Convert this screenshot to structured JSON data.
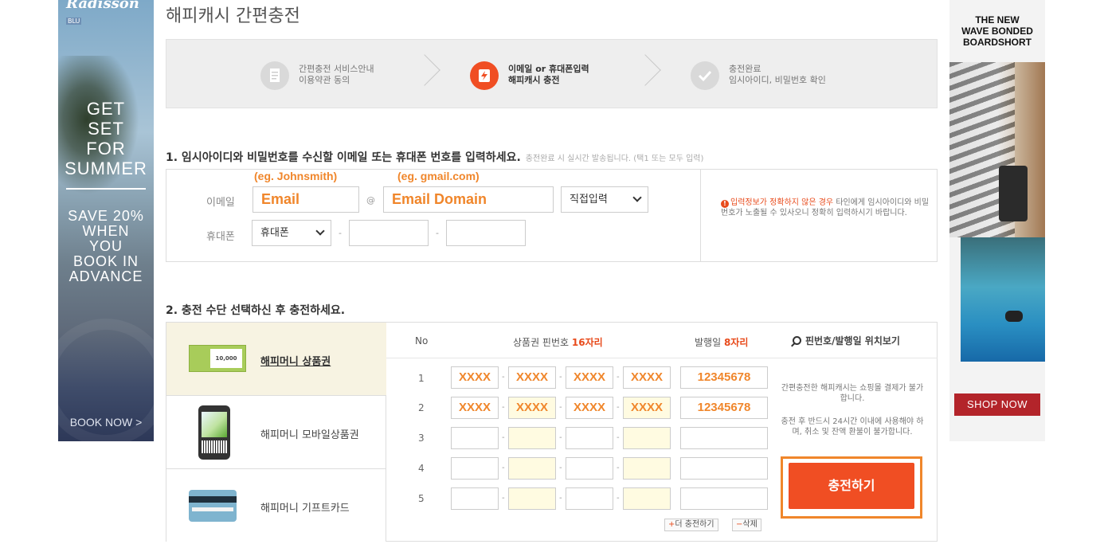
{
  "ads": {
    "left": {
      "brand": "Radisson",
      "brand_tag": "BLU",
      "headline_lines": [
        "GET",
        "SET",
        "FOR",
        "SUMMER"
      ],
      "offer_lines": [
        "SAVE 20%",
        "WHEN",
        "YOU",
        "BOOK IN",
        "ADVANCE"
      ],
      "cta": "BOOK NOW >"
    },
    "right": {
      "headline_lines": [
        "THE NEW",
        "WAVE BONDED",
        "BOARDSHORT"
      ],
      "cta": "SHOP NOW"
    }
  },
  "page": {
    "title": "해피캐시 간편충전"
  },
  "steps": [
    {
      "line1": "간편충전 서비스안내",
      "line2": "이용약관 동의",
      "icon": "document-icon",
      "active": false
    },
    {
      "line1": "이메일 or 휴대폰입력",
      "line2": "해피캐시 충전",
      "icon": "charge-icon",
      "active": true
    },
    {
      "line1": "충전완료",
      "line2": "임시아이디, 비밀번호 확인",
      "icon": "check-icon",
      "active": false
    }
  ],
  "section1": {
    "title": "1. 임시아이디와 비밀번호를 수신할 이메일 또는 휴대폰 번호를 입력하세요.",
    "hint": "충전완료 시 실시간 발송됩니다. (택1 또는 모두 입력)",
    "email_label": "이메일",
    "email_example": "(eg. Johnsmith)",
    "domain_example": "(eg. gmail.com)",
    "email_value": "Email",
    "at": "@",
    "domain_value": "Email Domain",
    "domain_select": "직접입력",
    "phone_label": "휴대폰",
    "phone_select": "휴대폰",
    "phone_dash": "-",
    "warning_highlight": "입력정보가 정확하지 않은 경우",
    "warning_rest": " 타인에게 임시아이디와 비밀번호가 노출될 수 있사오니 정확히 입력하시기 바랍니다."
  },
  "section2": {
    "title": "2. 충전 수단 선택하신 후 충전하세요.",
    "methods": [
      {
        "label": "해피머니 상품권",
        "active": true
      },
      {
        "label": "해피머니 모바일상품권",
        "active": false
      },
      {
        "label": "해피머니 기프트카드",
        "active": false
      }
    ],
    "voucher_text": "10,000",
    "columns": {
      "no": "No",
      "pin": "상품권 핀번호",
      "pin_len": "16자리",
      "issue": "발행일",
      "issue_len": "8자리",
      "find": "핀번호/발행일 위치보기"
    },
    "rows": [
      {
        "no": "1",
        "pins": [
          "XXXX",
          "XXXX",
          "XXXX",
          "XXXX"
        ],
        "date": "12345678"
      },
      {
        "no": "2",
        "pins": [
          "XXXX",
          "XXXX",
          "XXXX",
          "XXXX"
        ],
        "date": "12345678"
      },
      {
        "no": "3",
        "pins": [
          "",
          "",
          "",
          ""
        ],
        "date": ""
      },
      {
        "no": "4",
        "pins": [
          "",
          "",
          "",
          ""
        ],
        "date": ""
      },
      {
        "no": "5",
        "pins": [
          "",
          "",
          "",
          ""
        ],
        "date": ""
      }
    ],
    "pin_dash": "-",
    "note1": "간편충전한 해피캐시는 쇼핑몰 결제가 불가합니다.",
    "note2": "충전 후 반드시 24시간 이내에 사용해야 하며, 취소 및 잔액 환불이 불가합니다.",
    "charge_button": "충전하기",
    "more_plus": "+",
    "more_button": "더 충전하기",
    "delete_minus": "−",
    "delete_button": "삭제"
  },
  "colors": {
    "accent": "#f04e23",
    "highlight": "#f0862b",
    "warning": "#e84b1c"
  }
}
